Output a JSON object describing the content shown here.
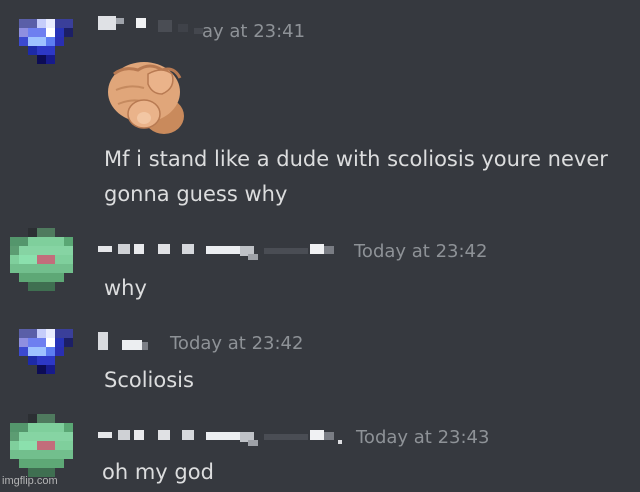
{
  "messages": [
    {
      "timestamp": "ay at 23:41",
      "lines": [
        "Mf i stand like a dude with scoliosis youre never",
        "gonna guess why"
      ],
      "has_emoji": true,
      "emoji_name": "pointing-hand-emoji"
    },
    {
      "timestamp": "Today at 23:42",
      "lines": [
        "why"
      ]
    },
    {
      "timestamp": "Today at 23:42",
      "lines": [
        "Scoliosis"
      ]
    },
    {
      "timestamp": "Today at 23:43",
      "lines": [
        "oh my god"
      ]
    }
  ],
  "colors": {
    "background": "#36393f",
    "text": "#dcddde",
    "timestamp": "#8e9297",
    "avatar_blue": "#6e7ff0",
    "avatar_green": "#7fcf9c"
  },
  "watermark": "imgflip.com"
}
